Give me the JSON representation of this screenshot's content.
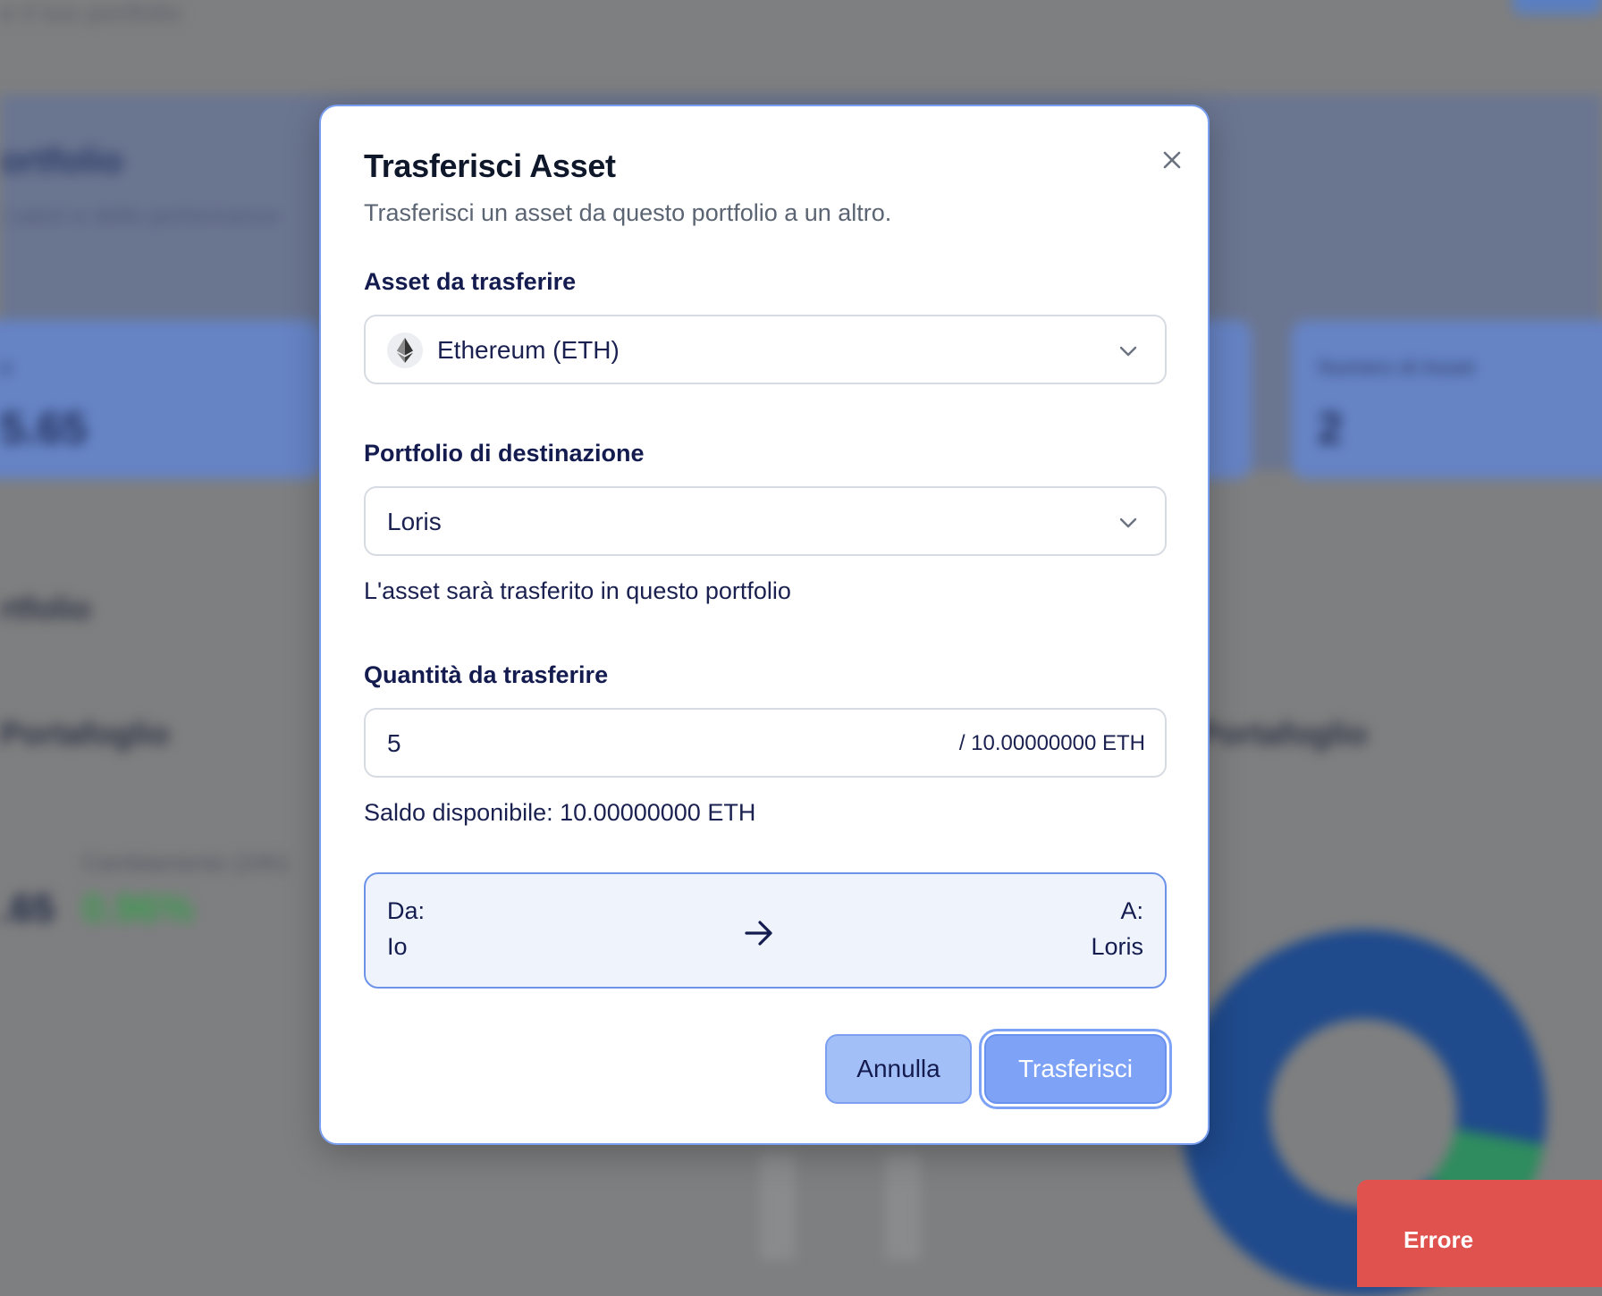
{
  "background": {
    "top_text": "e il tuo portfolio",
    "band_title": "ortfolio",
    "band_subtitle": "i valori e delle performance",
    "card1": {
      "label": "o",
      "value": "5.65"
    },
    "card2": {
      "label": "Numero di Asset",
      "value": "2"
    },
    "section1": "rtfolio",
    "section2_left": "Portafoglio",
    "section2_right": "Portafoglio",
    "change_label": "Cambiamento (24h)",
    "change_value": "0.96%",
    "value_left": ".65",
    "toast": "Errore"
  },
  "modal": {
    "title": "Trasferisci Asset",
    "subtitle": "Trasferisci un asset da questo portfolio a un altro.",
    "asset_label": "Asset da trasferire",
    "asset_selected": "Ethereum (ETH)",
    "asset_icon": "ethereum-icon",
    "dest_label": "Portfolio di destinazione",
    "dest_selected": "Loris",
    "dest_helper": "L'asset sarà trasferito in questo portfolio",
    "qty_label": "Quantità da trasferire",
    "qty_value": "5",
    "qty_suffix": "/ 10.00000000 ETH",
    "balance_text": "Saldo disponibile: 10.00000000 ETH",
    "summary": {
      "from_label": "Da:",
      "from_value": "Io",
      "to_label": "A:",
      "to_value": "Loris"
    },
    "cancel_label": "Annulla",
    "submit_label": "Trasferisci"
  },
  "colors": {
    "accent": "#7da2f6",
    "accent_border": "#6d93e9",
    "text_dark": "#131b4f",
    "error": "#e0524e"
  }
}
